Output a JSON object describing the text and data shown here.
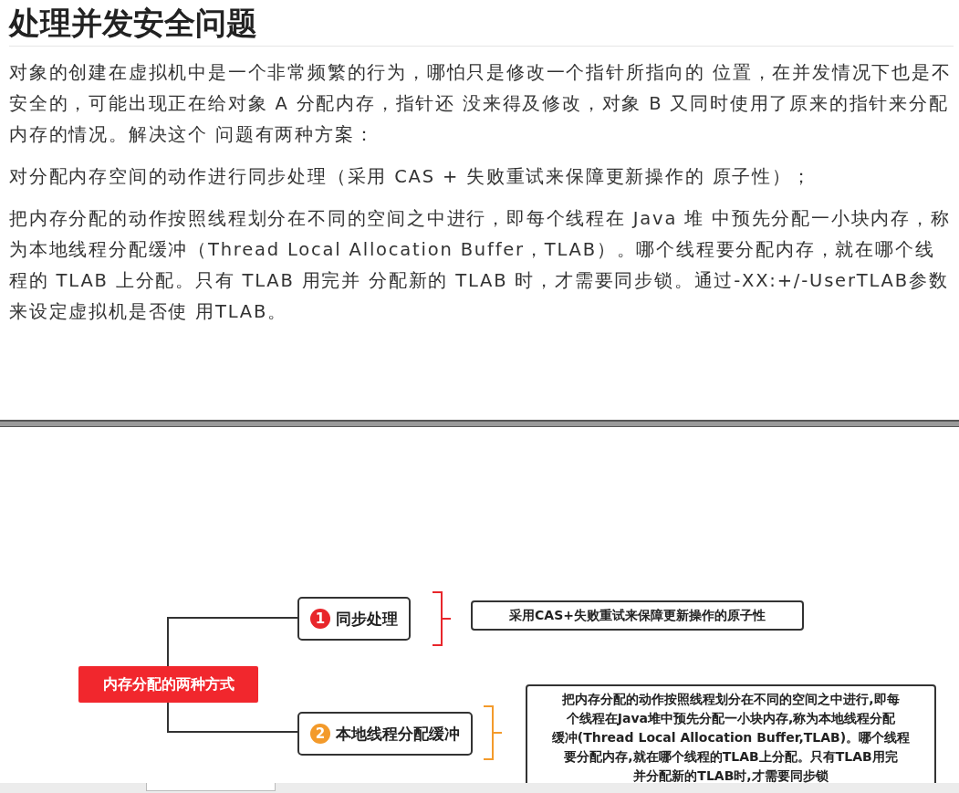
{
  "heading": "处理并发安全问题",
  "paragraphs": [
    "对象的创建在虚拟机中是一个非常频繁的行为，哪怕只是修改一个指针所指向的 位置，在并发情况下也是不安全的，可能出现正在给对象 A 分配内存，指针还 没来得及修改，对象 B 又同时使用了原来的指针来分配内存的情况。解决这个 问题有两种方案：",
    "对分配内存空间的动作进行同步处理（采用 CAS + 失败重试来保障更新操作的 原子性）；",
    "把内存分配的动作按照线程划分在不同的空间之中进行，即每个线程在 Java 堆 中预先分配一小块内存，称为本地线程分配缓冲（Thread Local Allocation Buffer，TLAB）。哪个线程要分配内存，就在哪个线程的 TLAB 上分配。只有 TLAB 用完并 分配新的 TLAB 时，才需要同步锁。通过-XX:+/-UserTLAB参数来设定虚拟机是否使 用TLAB。"
  ],
  "mindmap": {
    "root": "内存分配的两种方式",
    "branches": [
      {
        "number": "1",
        "label": "同步处理",
        "color": "#e8262b",
        "detail": [
          "采用CAS+失败重试来保障更新操作的原子性"
        ]
      },
      {
        "number": "2",
        "label": "本地线程分配缓冲",
        "color": "#f39a2b",
        "detail": [
          "把内存分配的动作按照线程划分在不同的空间之中进行,即每",
          "个线程在Java堆中预先分配一小块内存,称为本地线程分配",
          "缓冲(Thread Local Allocation Buffer,TLAB)。哪个线程",
          "要分配内存,就在哪个线程的TLAB上分配。只有TLAB用完",
          "并分配新的TLAB时,才需要同步锁"
        ]
      }
    ]
  }
}
